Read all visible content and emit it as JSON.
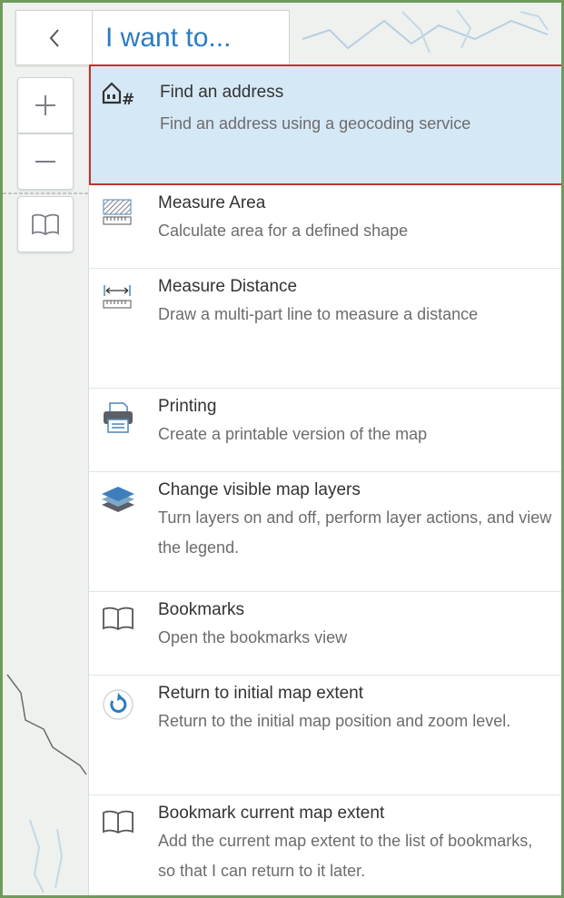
{
  "header": {
    "back_label": "<",
    "tab_title": "I want to..."
  },
  "map_controls": {
    "zoom_in_label": "+",
    "zoom_out_label": "—"
  },
  "menu": {
    "items": [
      {
        "title": "Find an address",
        "description": "Find an address using a geocoding service",
        "icon": "find-address-icon"
      },
      {
        "title": "Measure Area",
        "description": "Calculate area for a defined shape",
        "icon": "measure-area-icon"
      },
      {
        "title": "Measure Distance",
        "description": "Draw a multi-part line to measure a distance",
        "icon": "measure-distance-icon"
      },
      {
        "title": "Printing",
        "description": "Create a printable version of the map",
        "icon": "printer-icon"
      },
      {
        "title": "Change visible map layers",
        "description": "Turn layers on and off, perform layer actions, and view the legend.",
        "icon": "layers-icon"
      },
      {
        "title": "Bookmarks",
        "description": "Open the bookmarks view",
        "icon": "book-icon"
      },
      {
        "title": "Return to initial map extent",
        "description": "Return to the initial map position and zoom level.",
        "icon": "return-extent-icon"
      },
      {
        "title": "Bookmark current map extent",
        "description": "Add the current map extent to the list of bookmarks, so that I can return to it later.",
        "icon": "book-icon"
      }
    ]
  },
  "colors": {
    "accent": "#2b7cc2",
    "selected_bg": "#d5e8f6",
    "selected_border": "#c4322e",
    "window_border": "#6f9a5c"
  }
}
